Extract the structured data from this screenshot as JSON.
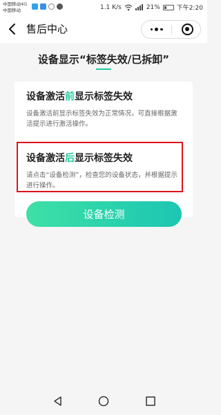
{
  "status_bar": {
    "carrier_line1": "中国移动4G",
    "carrier_line2": "中国移动",
    "speed": "1.1 K/s",
    "battery": "21%",
    "time": "下午2:20"
  },
  "nav": {
    "title": "售后中心"
  },
  "page": {
    "section_title": "设备显示“标签失效/已拆卸”",
    "item1": {
      "title_before": "设备激活",
      "title_highlight": "前",
      "title_after": "显示标签失效",
      "desc": "设备激活前显示标签失效为正常情况，可直接根据激活提示进行激活操作。"
    },
    "item2": {
      "title_before": "设备激活",
      "title_highlight": "后",
      "title_after": "显示标签失效",
      "desc": "请点击“设备检测”，检查您的设备状态，并根据提示进行操作。"
    },
    "detect_button": "设备检测"
  },
  "colors": {
    "accent": "#23c99c",
    "highlight_box": "#e0101a",
    "button_gradient": [
      "#3ee0a6",
      "#1cc6b2"
    ]
  },
  "icons": {
    "back": "chevron-left-icon",
    "more": "more-dots-icon",
    "close": "target-circle-icon",
    "sys_back": "triangle-back-icon",
    "sys_home": "circle-home-icon",
    "sys_recent": "square-recent-icon"
  }
}
